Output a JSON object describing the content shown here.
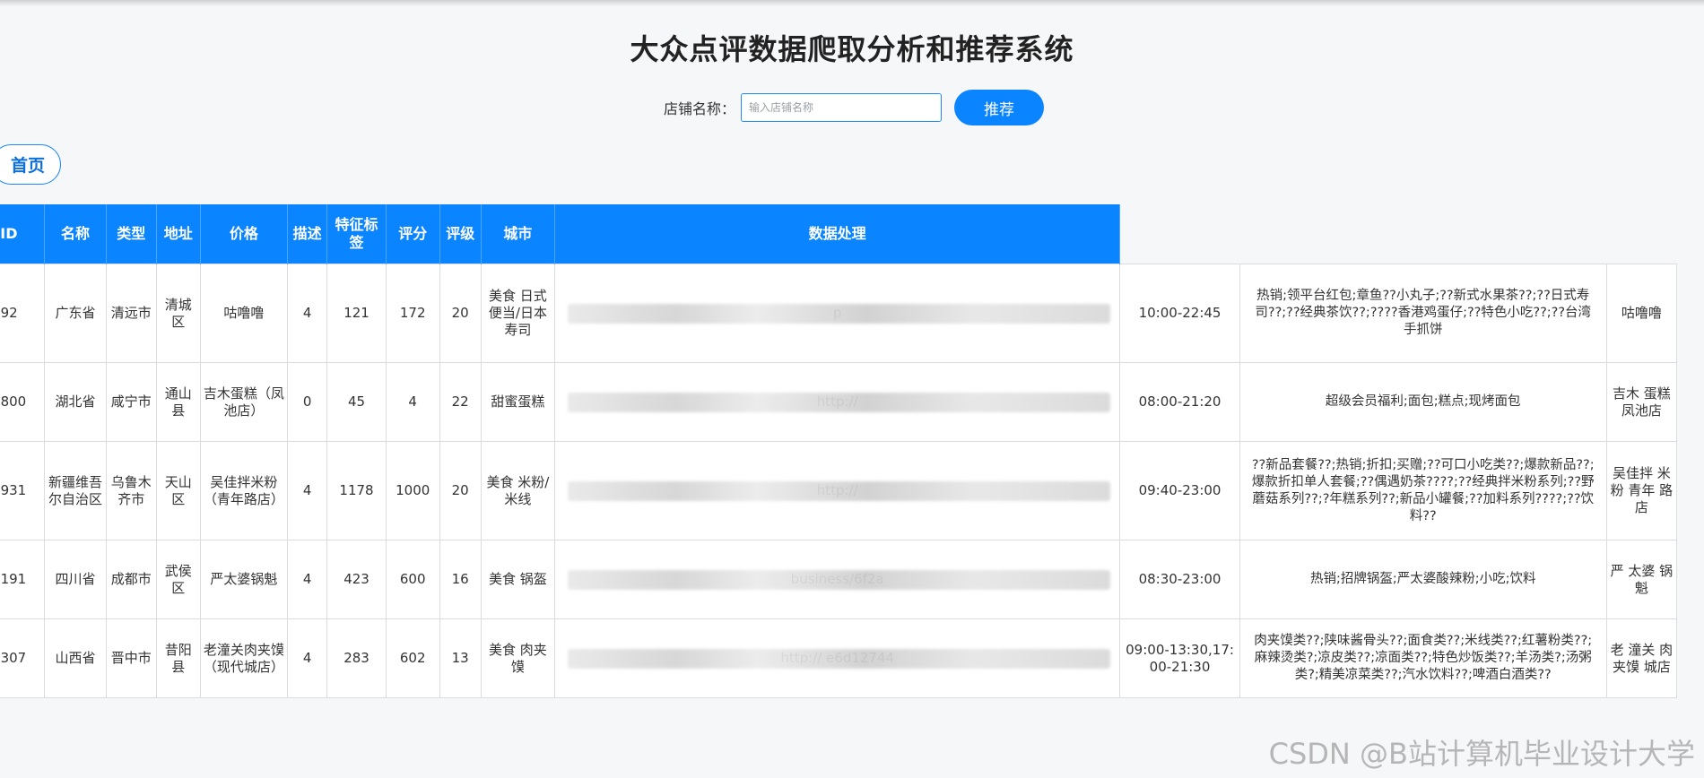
{
  "page": {
    "title": "大众点评数据爬取分析和推荐系统"
  },
  "search": {
    "label": "店铺名称：",
    "placeholder": "输入店铺名称",
    "value": "",
    "button_label": "推荐"
  },
  "nav": {
    "home_label": "首页"
  },
  "table": {
    "headers": [
      "ID",
      "名称",
      "类型",
      "地址",
      "价格",
      "描述",
      "特征标签",
      "评分",
      "评级",
      "城市",
      "数据处理"
    ],
    "rows": [
      {
        "c1": "92",
        "c2": "广东省",
        "c3": "清远市",
        "c4": "清城区",
        "c5": "咕噜噜",
        "c6": "4",
        "c7": "121",
        "c8": "172",
        "c9": "20",
        "c10": "美食 日式便当/日本寿司",
        "url": "p",
        "hours": "10:00-22:45",
        "tags": "热销;领平台红包;章鱼??小丸子;??新式水果茶??;??日式寿司??;??经典茶饮??;????香港鸡蛋仔;??特色小吃??;??台湾手抓饼",
        "shop": "咕噜噜"
      },
      {
        "c1": "1800",
        "c2": "湖北省",
        "c3": "咸宁市",
        "c4": "通山县",
        "c5": "吉木蛋糕（凤池店）",
        "c6": "0",
        "c7": "45",
        "c8": "4",
        "c9": "22",
        "c10": "甜蜜蛋糕",
        "url": "http://",
        "hours": "08:00-21:20",
        "tags": "超级会员福利;面包;糕点;现烤面包",
        "shop": "吉木 蛋糕 凤池店"
      },
      {
        "c1": "1931",
        "c2": "新疆维吾尔自治区",
        "c3": "乌鲁木齐市",
        "c4": "天山区",
        "c5": "吴佳拌米粉（青年路店）",
        "c6": "4",
        "c7": "1178",
        "c8": "1000",
        "c9": "20",
        "c10": "美食 米粉/米线",
        "url": "http://",
        "hours": "09:40-23:00",
        "tags": "??新品套餐??;热销;折扣;买赠;??可口小吃类??;爆款新品??;爆款折扣单人套餐;??偶遇奶茶????;??经典拌米粉系列;??野蘑菇系列??;?年糕系列??;新品小罐餐;??加料系列????;??饮料??",
        "shop": "吴佳拌 米粉 青年 路店"
      },
      {
        "c1": "2191",
        "c2": "四川省",
        "c3": "成都市",
        "c4": "武侯区",
        "c5": "严太婆锅魁",
        "c6": "4",
        "c7": "423",
        "c8": "600",
        "c9": "16",
        "c10": "美食 锅盔",
        "url": "business/6f2a",
        "hours": "08:30-23:00",
        "tags": "热销;招牌锅盔;严太婆酸辣粉;小吃;饮料",
        "shop": "严 太婆 锅魁"
      },
      {
        "c1": "3307",
        "c2": "山西省",
        "c3": "晋中市",
        "c4": "昔阳县",
        "c5": "老潼关肉夹馍（现代城店）",
        "c6": "4",
        "c7": "283",
        "c8": "602",
        "c9": "13",
        "c10": "美食 肉夹馍",
        "url": "http:// e6d12744",
        "hours": "09:00-13:30,17:00-21:30",
        "tags": "肉夹馍类??;陕味酱骨头??;面食类??;米线类??;红薯粉类??;麻辣烫类?;凉皮类??;凉面类??;特色炒饭类??;羊汤类?;汤粥类?;精美凉菜类??;汽水饮料??;啤酒白酒类??",
        "shop": "老 潼关 肉夹馍 城店"
      }
    ]
  },
  "watermark": "CSDN @B站计算机毕业设计大学"
}
